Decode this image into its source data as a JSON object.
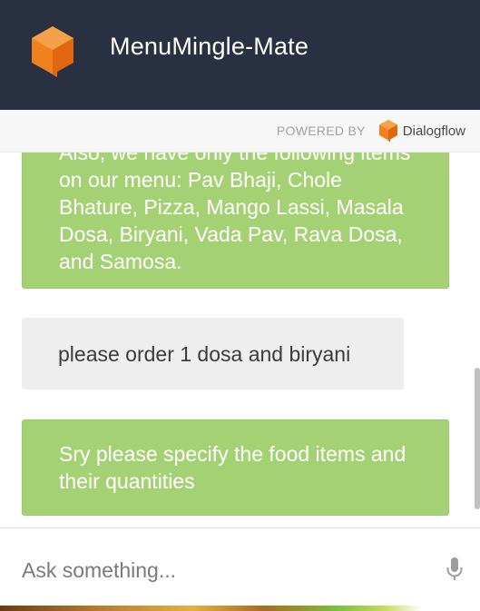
{
  "header": {
    "title": "MenuMingle-Mate",
    "logo_icon": "dialogflow-cube-icon"
  },
  "powered": {
    "label": "POWERED BY",
    "brand": "Dialogflow",
    "brand_icon": "dialogflow-icon"
  },
  "messages": [
    {
      "role": "bot",
      "text": "Also, we have only the following items on our menu: Pav Bhaji, Chole Bhature, Pizza, Mango Lassi, Masala Dosa, Biryani, Vada Pav, Rava Dosa, and Samosa."
    },
    {
      "role": "user",
      "text": "please order 1 dosa and biryani"
    },
    {
      "role": "bot",
      "text": "Sry please specify the food items and their quantities"
    }
  ],
  "input": {
    "placeholder": "Ask something...",
    "value": "",
    "mic_icon": "microphone-icon"
  },
  "colors": {
    "header_bg": "#283041",
    "bot_bubble": "#a5d175",
    "user_bubble": "#eeeeee",
    "brand_orange": "#ef7d1a"
  }
}
